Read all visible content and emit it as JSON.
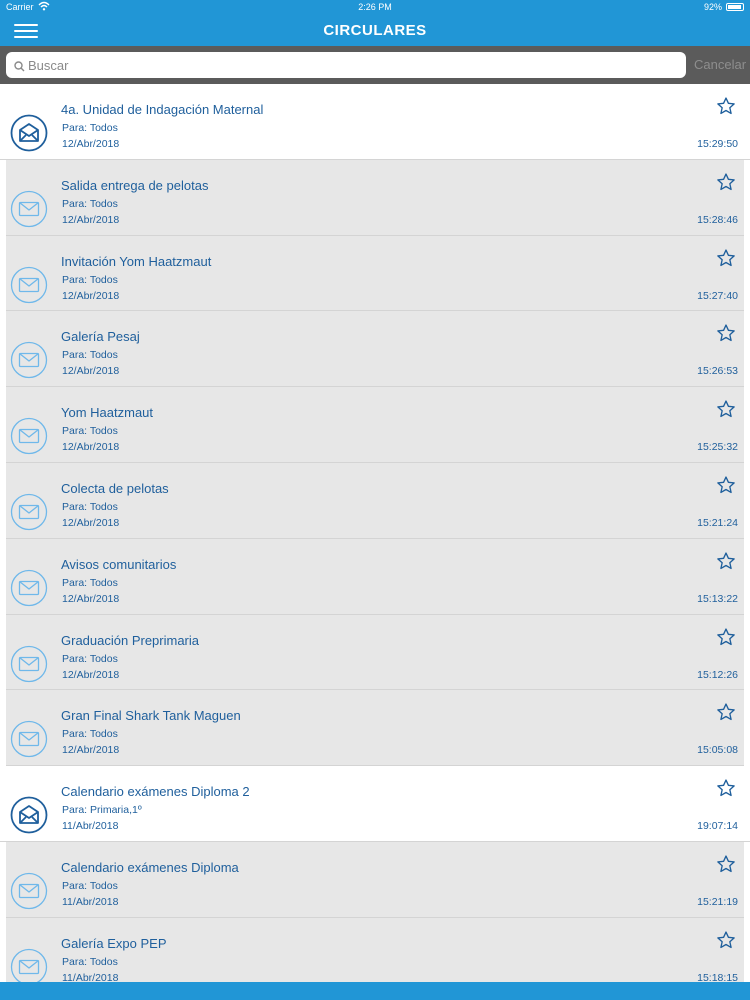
{
  "status_bar": {
    "carrier": "Carrier",
    "time": "2:26 PM",
    "battery": "92%",
    "battery_level": 0.92
  },
  "header": {
    "title": "CIRCULARES",
    "menu_icon": "hamburger-menu-icon"
  },
  "search": {
    "placeholder": "Buscar",
    "value": "",
    "cancel_label": "Cancelar"
  },
  "colors": {
    "brand_blue": "#2196d6",
    "text_blue": "#1f5f9c",
    "read_background": "#e7e7e7",
    "unread_icon": "#1f5f9c",
    "read_icon": "#6fb8ea"
  },
  "circulars": [
    {
      "title": "4a. Unidad de Indagación Maternal",
      "to": "Para: Todos",
      "date": "12/Abr/2018",
      "time": "15:29:50",
      "read": false,
      "starred": false
    },
    {
      "title": "Salida entrega de pelotas",
      "to": "Para: Todos",
      "date": "12/Abr/2018",
      "time": "15:28:46",
      "read": true,
      "starred": false
    },
    {
      "title": "Invitación Yom Haatzmaut",
      "to": "Para: Todos",
      "date": "12/Abr/2018",
      "time": "15:27:40",
      "read": true,
      "starred": false
    },
    {
      "title": "Galería Pesaj",
      "to": "Para: Todos",
      "date": "12/Abr/2018",
      "time": "15:26:53",
      "read": true,
      "starred": false
    },
    {
      "title": "Yom Haatzmaut",
      "to": "Para: Todos",
      "date": "12/Abr/2018",
      "time": "15:25:32",
      "read": true,
      "starred": false
    },
    {
      "title": "Colecta de pelotas",
      "to": "Para: Todos",
      "date": "12/Abr/2018",
      "time": "15:21:24",
      "read": true,
      "starred": false
    },
    {
      "title": "Avisos comunitarios",
      "to": "Para: Todos",
      "date": "12/Abr/2018",
      "time": "15:13:22",
      "read": true,
      "starred": false
    },
    {
      "title": "Graduación Preprimaria",
      "to": "Para: Todos",
      "date": "12/Abr/2018",
      "time": "15:12:26",
      "read": true,
      "starred": false
    },
    {
      "title": "Gran Final Shark Tank Maguen",
      "to": "Para: Todos",
      "date": "12/Abr/2018",
      "time": "15:05:08",
      "read": true,
      "starred": false
    },
    {
      "title": "Calendario exámenes Diploma 2",
      "to": "Para: Primaria,1º",
      "date": "11/Abr/2018",
      "time": "19:07:14",
      "read": false,
      "starred": false
    },
    {
      "title": "Calendario exámenes Diploma",
      "to": "Para: Todos",
      "date": "11/Abr/2018",
      "time": "15:21:19",
      "read": true,
      "starred": false
    },
    {
      "title": "Galería Expo PEP",
      "to": "Para: Todos",
      "date": "11/Abr/2018",
      "time": "15:18:15",
      "read": true,
      "starred": false
    }
  ]
}
